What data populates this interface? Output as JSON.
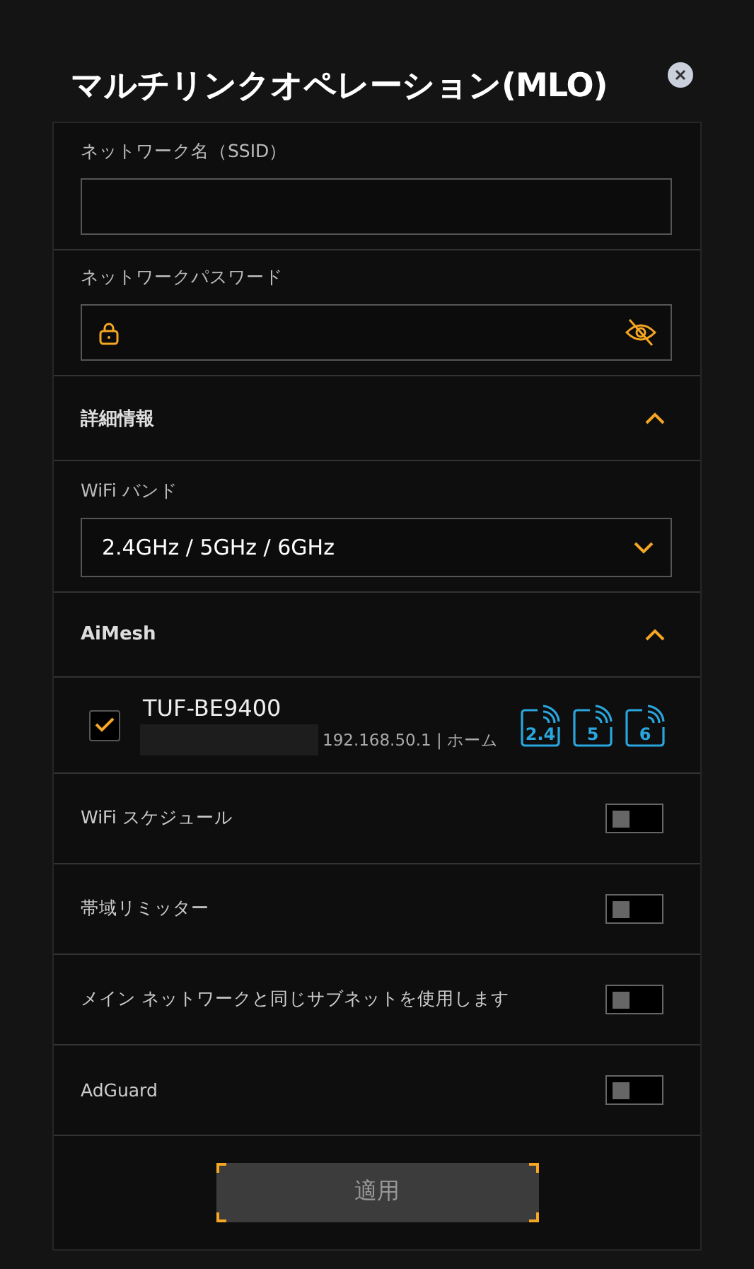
{
  "dialog": {
    "title": "マルチリンクオペレーション(MLO)"
  },
  "fields": [
    {
      "kind": "text",
      "label": "ネットワーク名（SSID）"
    },
    {
      "kind": "password",
      "label": "ネットワークパスワード"
    }
  ],
  "advanced": {
    "title": "詳細情報",
    "expanded": true,
    "band_label": "WiFi バンド",
    "band_value": "2.4GHz / 5GHz / 6GHz"
  },
  "aimesh": {
    "title": "AiMesh",
    "expanded": true,
    "devices": [
      {
        "name": "TUF-BE9400",
        "checked": true,
        "address": "192.168.50.1 | ホーム",
        "bands": [
          "2.4",
          "5",
          "6"
        ]
      }
    ]
  },
  "toggles": [
    {
      "label": "WiFi スケジュール",
      "on": false
    },
    {
      "label": "帯域リミッター",
      "on": false
    },
    {
      "label": "メイン ネットワークと同じサブネットを使用します",
      "on": false
    },
    {
      "label": "AdGuard",
      "on": false
    }
  ],
  "apply_button": "適用"
}
